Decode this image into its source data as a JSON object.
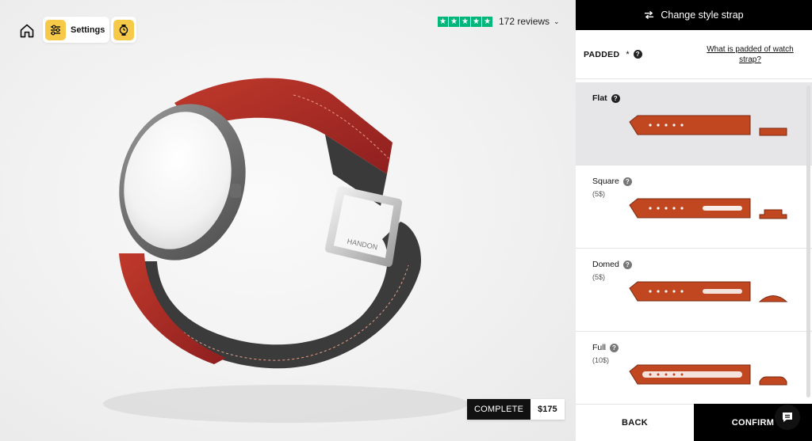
{
  "toolbar": {
    "home_icon": "home-icon",
    "settings_label": "Settings",
    "settings_icon": "sliders-icon",
    "watch_icon": "watch-icon"
  },
  "reviews": {
    "rating_stars": 5,
    "text": "172 reviews",
    "star_color": "#00b67a"
  },
  "watch": {
    "buckle_text": "HANDON",
    "strap_color": "#b22c2c"
  },
  "summary": {
    "complete_label": "COMPLETE",
    "price": "$175"
  },
  "panel": {
    "header_label": "Change style strap",
    "header_icon": "swap-icon",
    "section_label": "PADDED",
    "required_mark": "*",
    "help_link": "What is padded of watch strap?",
    "options": [
      {
        "name": "Flat",
        "price": "",
        "selected": true
      },
      {
        "name": "Square",
        "price": "(5$)",
        "selected": false
      },
      {
        "name": "Domed",
        "price": "(5$)",
        "selected": false
      },
      {
        "name": "Full",
        "price": "(10$)",
        "selected": false
      }
    ],
    "back_label": "BACK",
    "confirm_label": "CONFIRM",
    "accent_color": "#f7c948"
  }
}
